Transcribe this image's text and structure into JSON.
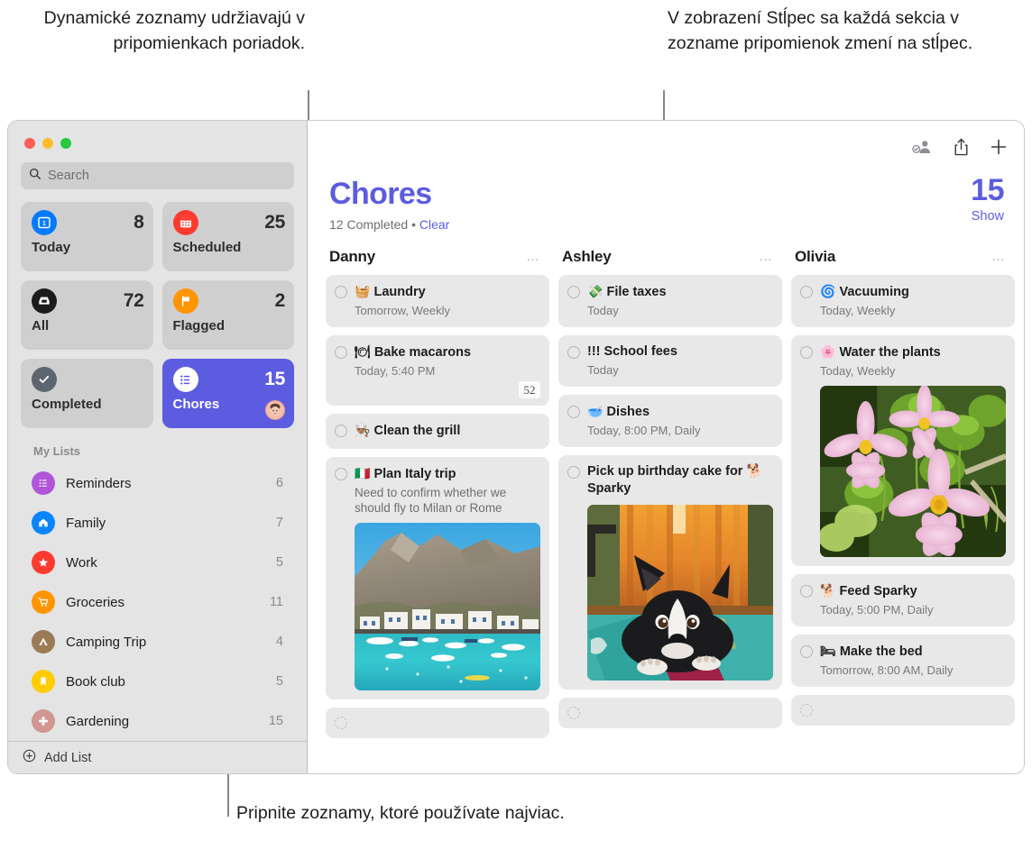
{
  "annotations": {
    "top_left": "Dynamické zoznamy udržiavajú v pripomienkach poriadok.",
    "top_right": "V zobrazení Stĺpec sa každá sekcia v zozname pripomienok zmení na stĺpec.",
    "bottom_left": "Pripnite zoznamy, ktoré používate najviac."
  },
  "sidebar": {
    "search": {
      "placeholder": "Search",
      "icon": "search-icon"
    },
    "smart_lists": [
      {
        "label": "Today",
        "count": "8",
        "icon": "today-calendar-icon",
        "color": "#007aff",
        "selected": false
      },
      {
        "label": "Scheduled",
        "count": "25",
        "icon": "scheduled-calendar-icon",
        "color": "#ff3b30",
        "selected": false
      },
      {
        "label": "All",
        "count": "72",
        "icon": "all-inbox-icon",
        "color": "#1c1c1e",
        "selected": false
      },
      {
        "label": "Flagged",
        "count": "2",
        "icon": "flag-icon",
        "color": "#ff9500",
        "selected": false
      },
      {
        "label": "Completed",
        "count": "",
        "icon": "checkmark-icon",
        "color": "#5d6570",
        "selected": false
      },
      {
        "label": "Chores",
        "count": "15",
        "icon": "list-bullet-icon",
        "color": "#ffffff",
        "selected": true,
        "shared_avatar": "shared-avatar"
      }
    ],
    "my_lists_header": "My Lists",
    "lists": [
      {
        "label": "Reminders",
        "count": "6",
        "icon": "list-bullet-icon",
        "color": "#b055d8"
      },
      {
        "label": "Family",
        "count": "7",
        "icon": "house-icon",
        "color": "#0a84ff"
      },
      {
        "label": "Work",
        "count": "5",
        "icon": "star-icon",
        "color": "#ff3b30"
      },
      {
        "label": "Groceries",
        "count": "11",
        "icon": "cart-icon",
        "color": "#ff9500"
      },
      {
        "label": "Camping Trip",
        "count": "4",
        "icon": "tent-icon",
        "color": "#9a7b56"
      },
      {
        "label": "Book club",
        "count": "5",
        "icon": "bookmark-icon",
        "color": "#ffcc00"
      },
      {
        "label": "Gardening",
        "count": "15",
        "icon": "flower-icon",
        "color": "#d09691"
      }
    ],
    "add_list": {
      "label": "Add List",
      "icon": "plus-circle-icon"
    }
  },
  "main": {
    "toolbar": [
      {
        "name": "share-people-icon",
        "label": ""
      },
      {
        "name": "share-export-icon",
        "label": ""
      },
      {
        "name": "add-reminder-plus-icon",
        "label": ""
      }
    ],
    "title": "Chores",
    "title_color": "#5c5ce0",
    "completed_text": "12 Completed",
    "separator": "•",
    "clear_label": "Clear",
    "count": "15",
    "show_label": "Show",
    "columns": [
      {
        "name": "Danny",
        "menu": "…",
        "tasks": [
          {
            "emoji": "🧺",
            "title": "Laundry",
            "sub": "Tomorrow, Weekly"
          },
          {
            "emoji": "🍽",
            "title": "Bake macarons",
            "sub": "Today, 5:40 PM",
            "badge": "52"
          },
          {
            "emoji": "👨🏽‍🍳",
            "title": "Clean the grill",
            "sub": ""
          },
          {
            "emoji": "🇮🇹",
            "title": "Plan Italy trip",
            "note": "Need to confirm whether we should fly to Milan or Rome",
            "photo": "italy-coast-photo"
          },
          {
            "emoji": "",
            "title": "",
            "sub": "",
            "empty": true
          }
        ]
      },
      {
        "name": "Ashley",
        "menu": "…",
        "tasks": [
          {
            "emoji": "💸",
            "title": "File taxes",
            "sub": "Today"
          },
          {
            "emoji": "",
            "title": "!!! School fees",
            "sub": "Today"
          },
          {
            "emoji": "🥣",
            "title": "Dishes",
            "sub": "Today, 8:00 PM, Daily"
          },
          {
            "emoji": "",
            "title": "Pick up birthday cake for 🐕 Sparky",
            "photo": "dog-sparky-photo"
          },
          {
            "emoji": "",
            "title": "",
            "sub": "",
            "empty": true
          }
        ]
      },
      {
        "name": "Olivia",
        "menu": "…",
        "tasks": [
          {
            "emoji": "🌀",
            "title": "Vacuuming",
            "sub": "Today, Weekly"
          },
          {
            "emoji": "🌸",
            "title": "Water the plants",
            "sub": "Today, Weekly",
            "photo": "pink-flowers-photo"
          },
          {
            "emoji": "🐕",
            "title": "Feed Sparky",
            "sub": "Today, 5:00 PM, Daily"
          },
          {
            "emoji": "🛏",
            "title": "Make the bed",
            "sub": "Tomorrow, 8:00 AM, Daily"
          },
          {
            "emoji": "",
            "title": "",
            "sub": "",
            "empty": true
          }
        ]
      }
    ]
  }
}
